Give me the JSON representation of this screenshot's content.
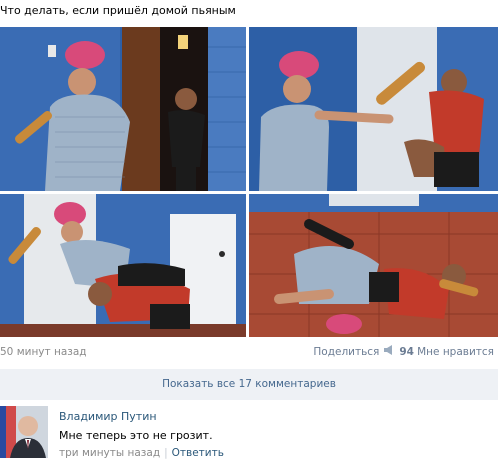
{
  "post": {
    "title": "Что делать, если пришёл домой пьяным"
  },
  "meta": {
    "time": "50 минут назад",
    "share_label": "Поделиться",
    "share_count": "94",
    "like_label": "Мне нравится"
  },
  "comments": {
    "show_all_label": "Показать все 17 комментариев",
    "items": [
      {
        "author": "Владимир Путин",
        "text": "Мне теперь это не грозит.",
        "time": "три минуты назад",
        "reply_label": "Ответить"
      }
    ]
  },
  "colors": {
    "link": "#2b587a",
    "muted": "#8a8a8a",
    "show_all_bg": "#eef1f5",
    "wall_blue": "#2f5fa8"
  },
  "icons": {
    "share": "megaphone-icon"
  }
}
